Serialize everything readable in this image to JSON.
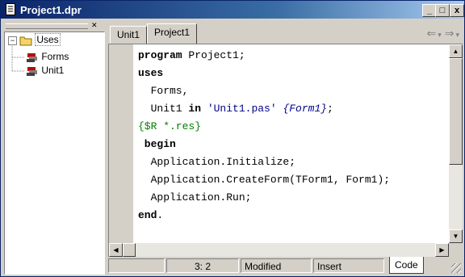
{
  "window": {
    "title": "Project1.dpr",
    "controls": {
      "minimize": "_",
      "maximize": "□",
      "close": "x"
    }
  },
  "tree": {
    "root": {
      "expander": "⊟",
      "label": "Uses",
      "icon": "folder-icon"
    },
    "children": [
      {
        "label": "Forms",
        "icon": "unit-icon"
      },
      {
        "label": "Unit1",
        "icon": "unit-icon"
      }
    ]
  },
  "tabs": [
    {
      "label": "Unit1",
      "active": false
    },
    {
      "label": "Project1",
      "active": true
    }
  ],
  "nav": {
    "back": "⇐",
    "forward": "⇒",
    "back_dropdown": "▾",
    "forward_dropdown": "▾"
  },
  "code": [
    {
      "parts": [
        {
          "t": "program",
          "c": "kw"
        },
        {
          "t": " Project1;",
          "c": ""
        }
      ]
    },
    {
      "parts": [
        {
          "t": "uses",
          "c": "kw"
        }
      ]
    },
    {
      "parts": [
        {
          "t": "  Forms,",
          "c": ""
        }
      ]
    },
    {
      "parts": [
        {
          "t": "  Unit1 ",
          "c": ""
        },
        {
          "t": "in",
          "c": "kw"
        },
        {
          "t": " 'Unit1.pas' ",
          "c": "str"
        },
        {
          "t": "{Form1}",
          "c": "cmt"
        },
        {
          "t": ";",
          "c": ""
        }
      ]
    },
    {
      "parts": [
        {
          "t": "{$R *.res}",
          "c": "dir"
        }
      ]
    },
    {
      "parts": [
        {
          "t": " begin",
          "c": "kw"
        }
      ]
    },
    {
      "parts": [
        {
          "t": "  Application.Initialize;",
          "c": ""
        }
      ]
    },
    {
      "parts": [
        {
          "t": "  Application.CreateForm(TForm1, Form1);",
          "c": ""
        }
      ]
    },
    {
      "parts": [
        {
          "t": "  Application.Run;",
          "c": ""
        }
      ]
    },
    {
      "parts": [
        {
          "t": "end",
          "c": "kw"
        },
        {
          "t": ".",
          "c": ""
        }
      ]
    }
  ],
  "status": {
    "position": "3: 2",
    "modified": "Modified",
    "mode": "Insert",
    "code_tab": "Code"
  }
}
